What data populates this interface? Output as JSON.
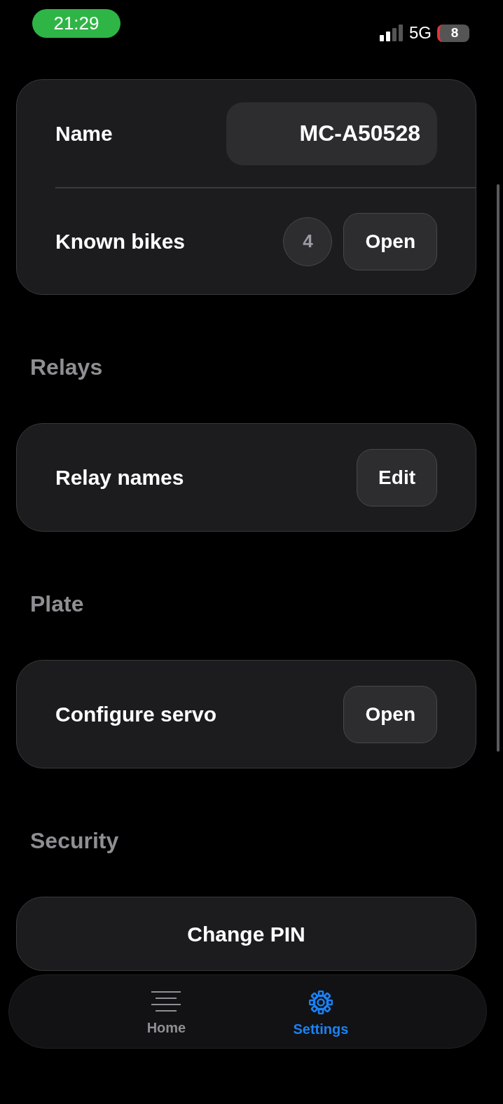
{
  "status_bar": {
    "time": "21:29",
    "network": "5G",
    "battery": "8"
  },
  "sections": [
    {
      "rows": [
        {
          "kind": "field",
          "label": "Name",
          "value": "MC-A50528"
        },
        {
          "kind": "count_button",
          "label": "Known bikes",
          "count": "4",
          "button": "Open"
        }
      ]
    },
    {
      "header": "Relays",
      "rows": [
        {
          "kind": "button",
          "label": "Relay names",
          "button": "Edit"
        }
      ]
    },
    {
      "header": "Plate",
      "rows": [
        {
          "kind": "button",
          "label": "Configure servo",
          "button": "Open"
        }
      ]
    },
    {
      "header": "Security",
      "rows": [
        {
          "kind": "full_button",
          "label": "Change PIN"
        }
      ]
    }
  ],
  "tabs": [
    {
      "label": "Home",
      "kind": "lines",
      "selected": false
    },
    {
      "label": "Settings",
      "kind": "gear",
      "selected": true
    }
  ]
}
